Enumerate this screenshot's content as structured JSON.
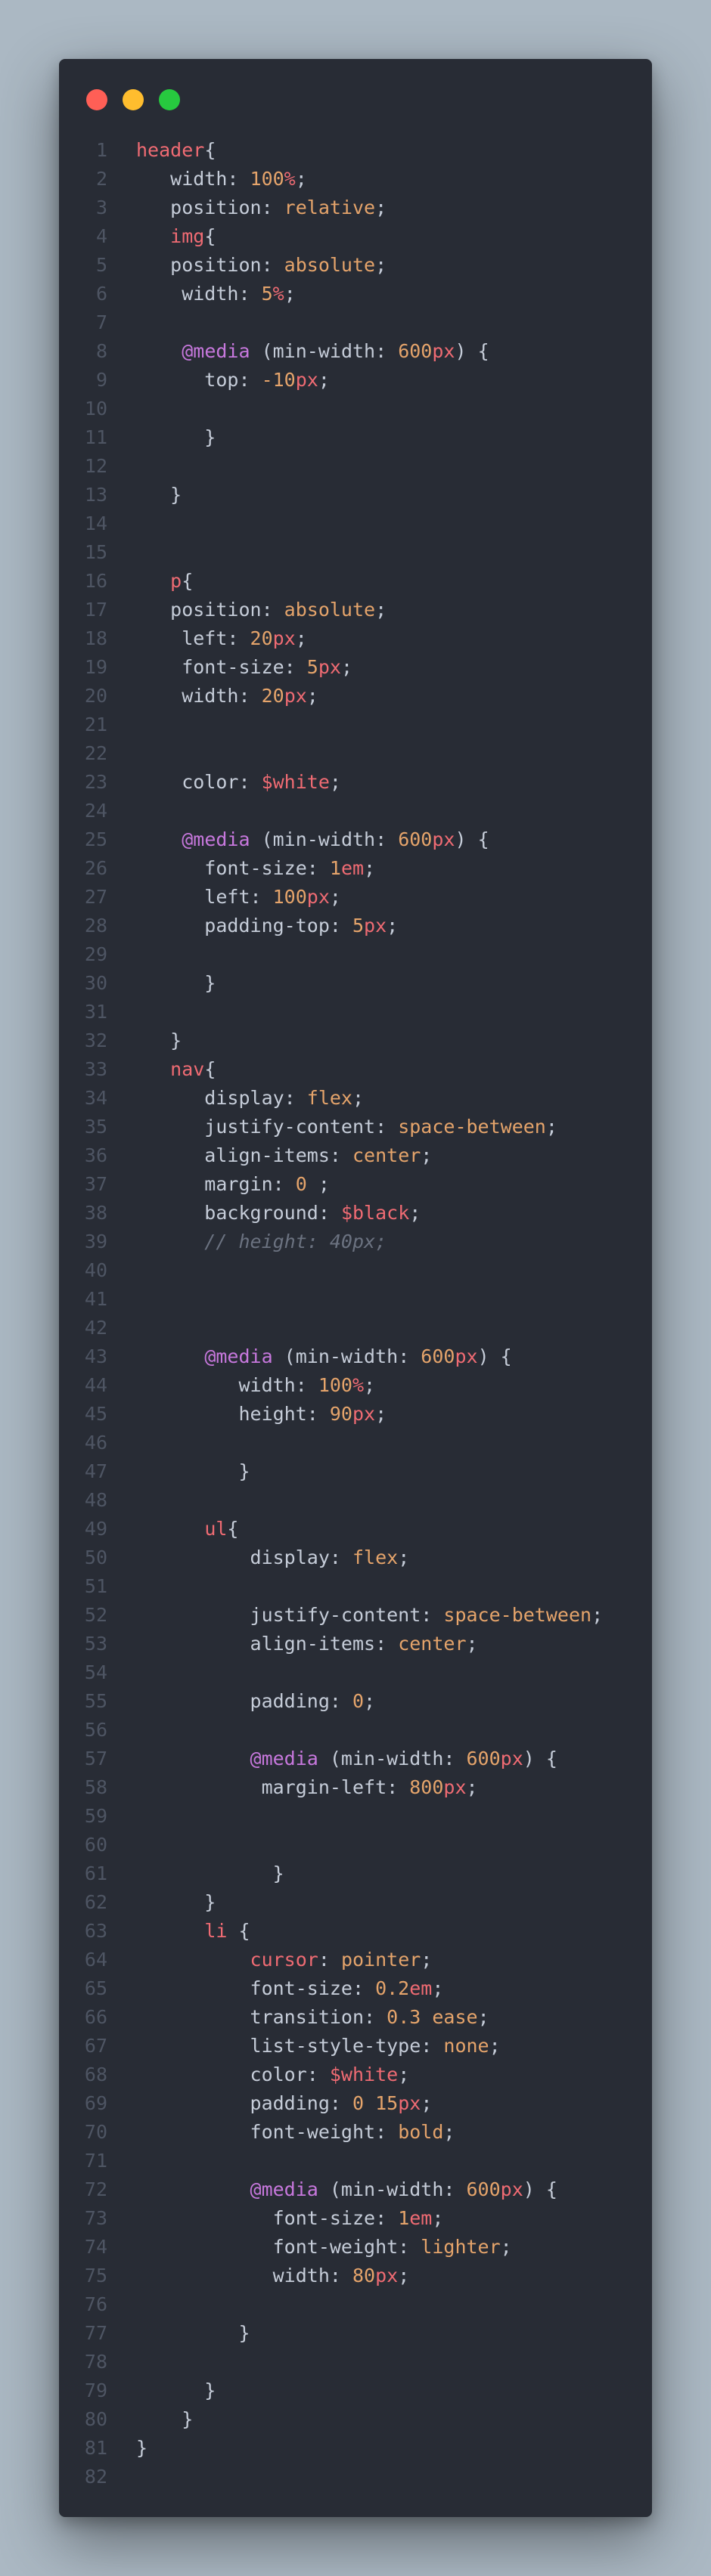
{
  "window": {
    "controls": [
      {
        "name": "close",
        "color": "#ff5f56"
      },
      {
        "name": "minimize",
        "color": "#ffbd2e"
      },
      {
        "name": "maximize",
        "color": "#27c93f"
      }
    ]
  },
  "code": {
    "lines": [
      [
        {
          "t": "header",
          "c": "sel"
        },
        {
          "t": "{",
          "c": "pun"
        }
      ],
      [
        {
          "t": "   width: ",
          "c": "prop"
        },
        {
          "t": "100",
          "c": "num"
        },
        {
          "t": "%",
          "c": "unit"
        },
        {
          "t": ";",
          "c": "pun"
        }
      ],
      [
        {
          "t": "   position: ",
          "c": "prop"
        },
        {
          "t": "relative",
          "c": "val"
        },
        {
          "t": ";",
          "c": "pun"
        }
      ],
      [
        {
          "t": "   ",
          "c": "pun"
        },
        {
          "t": "img",
          "c": "sel"
        },
        {
          "t": "{",
          "c": "pun"
        }
      ],
      [
        {
          "t": "   position: ",
          "c": "prop"
        },
        {
          "t": "absolute",
          "c": "val"
        },
        {
          "t": ";",
          "c": "pun"
        }
      ],
      [
        {
          "t": "    width: ",
          "c": "prop"
        },
        {
          "t": "5",
          "c": "num"
        },
        {
          "t": "%",
          "c": "unit"
        },
        {
          "t": ";",
          "c": "pun"
        }
      ],
      [],
      [
        {
          "t": "    ",
          "c": "pun"
        },
        {
          "t": "@media",
          "c": "at"
        },
        {
          "t": " (min-width: ",
          "c": "prop"
        },
        {
          "t": "600",
          "c": "num"
        },
        {
          "t": "px",
          "c": "unit"
        },
        {
          "t": ") {",
          "c": "pun"
        }
      ],
      [
        {
          "t": "      top: ",
          "c": "prop"
        },
        {
          "t": "-10",
          "c": "num"
        },
        {
          "t": "px",
          "c": "unit"
        },
        {
          "t": ";",
          "c": "pun"
        }
      ],
      [],
      [
        {
          "t": "      }",
          "c": "pun"
        }
      ],
      [],
      [
        {
          "t": "   }",
          "c": "pun"
        }
      ],
      [],
      [],
      [
        {
          "t": "   ",
          "c": "pun"
        },
        {
          "t": "p",
          "c": "sel"
        },
        {
          "t": "{",
          "c": "pun"
        }
      ],
      [
        {
          "t": "   position: ",
          "c": "prop"
        },
        {
          "t": "absolute",
          "c": "val"
        },
        {
          "t": ";",
          "c": "pun"
        }
      ],
      [
        {
          "t": "    left: ",
          "c": "prop"
        },
        {
          "t": "20",
          "c": "num"
        },
        {
          "t": "px",
          "c": "unit"
        },
        {
          "t": ";",
          "c": "pun"
        }
      ],
      [
        {
          "t": "    font-size: ",
          "c": "prop"
        },
        {
          "t": "5",
          "c": "num"
        },
        {
          "t": "px",
          "c": "unit"
        },
        {
          "t": ";",
          "c": "pun"
        }
      ],
      [
        {
          "t": "    width: ",
          "c": "prop"
        },
        {
          "t": "20",
          "c": "num"
        },
        {
          "t": "px",
          "c": "unit"
        },
        {
          "t": ";",
          "c": "pun"
        }
      ],
      [],
      [],
      [
        {
          "t": "    color: ",
          "c": "prop"
        },
        {
          "t": "$white",
          "c": "var"
        },
        {
          "t": ";",
          "c": "pun"
        }
      ],
      [],
      [
        {
          "t": "    ",
          "c": "pun"
        },
        {
          "t": "@media",
          "c": "at"
        },
        {
          "t": " (min-width: ",
          "c": "prop"
        },
        {
          "t": "600",
          "c": "num"
        },
        {
          "t": "px",
          "c": "unit"
        },
        {
          "t": ") {",
          "c": "pun"
        }
      ],
      [
        {
          "t": "      font-size: ",
          "c": "prop"
        },
        {
          "t": "1",
          "c": "num"
        },
        {
          "t": "em",
          "c": "unit"
        },
        {
          "t": ";",
          "c": "pun"
        }
      ],
      [
        {
          "t": "      left: ",
          "c": "prop"
        },
        {
          "t": "100",
          "c": "num"
        },
        {
          "t": "px",
          "c": "unit"
        },
        {
          "t": ";",
          "c": "pun"
        }
      ],
      [
        {
          "t": "      padding-top: ",
          "c": "prop"
        },
        {
          "t": "5",
          "c": "num"
        },
        {
          "t": "px",
          "c": "unit"
        },
        {
          "t": ";",
          "c": "pun"
        }
      ],
      [],
      [
        {
          "t": "      }",
          "c": "pun"
        }
      ],
      [],
      [
        {
          "t": "   }",
          "c": "pun"
        }
      ],
      [
        {
          "t": "   ",
          "c": "pun"
        },
        {
          "t": "nav",
          "c": "sel"
        },
        {
          "t": "{",
          "c": "pun"
        }
      ],
      [
        {
          "t": "      display: ",
          "c": "prop"
        },
        {
          "t": "flex",
          "c": "val"
        },
        {
          "t": ";",
          "c": "pun"
        }
      ],
      [
        {
          "t": "      justify-content: ",
          "c": "prop"
        },
        {
          "t": "space-between",
          "c": "val"
        },
        {
          "t": ";",
          "c": "pun"
        }
      ],
      [
        {
          "t": "      align-items: ",
          "c": "prop"
        },
        {
          "t": "center",
          "c": "val"
        },
        {
          "t": ";",
          "c": "pun"
        }
      ],
      [
        {
          "t": "      margin: ",
          "c": "prop"
        },
        {
          "t": "0",
          "c": "num"
        },
        {
          "t": " ;",
          "c": "pun"
        }
      ],
      [
        {
          "t": "      background: ",
          "c": "prop"
        },
        {
          "t": "$black",
          "c": "var"
        },
        {
          "t": ";",
          "c": "pun"
        }
      ],
      [
        {
          "t": "      // height: 40px;",
          "c": "cmt"
        }
      ],
      [],
      [],
      [],
      [
        {
          "t": "      ",
          "c": "pun"
        },
        {
          "t": "@media",
          "c": "at"
        },
        {
          "t": " (min-width: ",
          "c": "prop"
        },
        {
          "t": "600",
          "c": "num"
        },
        {
          "t": "px",
          "c": "unit"
        },
        {
          "t": ") {",
          "c": "pun"
        }
      ],
      [
        {
          "t": "         width: ",
          "c": "prop"
        },
        {
          "t": "100",
          "c": "num"
        },
        {
          "t": "%",
          "c": "unit"
        },
        {
          "t": ";",
          "c": "pun"
        }
      ],
      [
        {
          "t": "         height: ",
          "c": "prop"
        },
        {
          "t": "90",
          "c": "num"
        },
        {
          "t": "px",
          "c": "unit"
        },
        {
          "t": ";",
          "c": "pun"
        }
      ],
      [],
      [
        {
          "t": "         }",
          "c": "pun"
        }
      ],
      [],
      [
        {
          "t": "      ",
          "c": "pun"
        },
        {
          "t": "ul",
          "c": "sel"
        },
        {
          "t": "{",
          "c": "pun"
        }
      ],
      [
        {
          "t": "          display: ",
          "c": "prop"
        },
        {
          "t": "flex",
          "c": "val"
        },
        {
          "t": ";",
          "c": "pun"
        }
      ],
      [],
      [
        {
          "t": "          justify-content: ",
          "c": "prop"
        },
        {
          "t": "space-between",
          "c": "val"
        },
        {
          "t": ";",
          "c": "pun"
        }
      ],
      [
        {
          "t": "          align-items: ",
          "c": "prop"
        },
        {
          "t": "center",
          "c": "val"
        },
        {
          "t": ";",
          "c": "pun"
        }
      ],
      [],
      [
        {
          "t": "          padding: ",
          "c": "prop"
        },
        {
          "t": "0",
          "c": "num"
        },
        {
          "t": ";",
          "c": "pun"
        }
      ],
      [],
      [
        {
          "t": "          ",
          "c": "pun"
        },
        {
          "t": "@media",
          "c": "at"
        },
        {
          "t": " (min-width: ",
          "c": "prop"
        },
        {
          "t": "600",
          "c": "num"
        },
        {
          "t": "px",
          "c": "unit"
        },
        {
          "t": ") {",
          "c": "pun"
        }
      ],
      [
        {
          "t": "           margin-left: ",
          "c": "prop"
        },
        {
          "t": "800",
          "c": "num"
        },
        {
          "t": "px",
          "c": "unit"
        },
        {
          "t": ";",
          "c": "pun"
        }
      ],
      [],
      [],
      [
        {
          "t": "            }",
          "c": "pun"
        }
      ],
      [
        {
          "t": "      }",
          "c": "pun"
        }
      ],
      [
        {
          "t": "      ",
          "c": "pun"
        },
        {
          "t": "li",
          "c": "sel"
        },
        {
          "t": " {",
          "c": "pun"
        }
      ],
      [
        {
          "t": "          ",
          "c": "pun"
        },
        {
          "t": "cursor",
          "c": "prophl"
        },
        {
          "t": ": ",
          "c": "prop"
        },
        {
          "t": "pointer",
          "c": "val"
        },
        {
          "t": ";",
          "c": "pun"
        }
      ],
      [
        {
          "t": "          font-size: ",
          "c": "prop"
        },
        {
          "t": "0.2",
          "c": "num"
        },
        {
          "t": "em",
          "c": "unit"
        },
        {
          "t": ";",
          "c": "pun"
        }
      ],
      [
        {
          "t": "          transition: ",
          "c": "prop"
        },
        {
          "t": "0.3",
          "c": "num"
        },
        {
          "t": " ease",
          "c": "val"
        },
        {
          "t": ";",
          "c": "pun"
        }
      ],
      [
        {
          "t": "          list-style-type: ",
          "c": "prop"
        },
        {
          "t": "none",
          "c": "val"
        },
        {
          "t": ";",
          "c": "pun"
        }
      ],
      [
        {
          "t": "          color: ",
          "c": "prop"
        },
        {
          "t": "$white",
          "c": "var"
        },
        {
          "t": ";",
          "c": "pun"
        }
      ],
      [
        {
          "t": "          padding: ",
          "c": "prop"
        },
        {
          "t": "0 15",
          "c": "num"
        },
        {
          "t": "px",
          "c": "unit"
        },
        {
          "t": ";",
          "c": "pun"
        }
      ],
      [
        {
          "t": "          font-weight: ",
          "c": "prop"
        },
        {
          "t": "bold",
          "c": "val"
        },
        {
          "t": ";",
          "c": "pun"
        }
      ],
      [],
      [
        {
          "t": "          ",
          "c": "pun"
        },
        {
          "t": "@media",
          "c": "at"
        },
        {
          "t": " (min-width: ",
          "c": "prop"
        },
        {
          "t": "600",
          "c": "num"
        },
        {
          "t": "px",
          "c": "unit"
        },
        {
          "t": ") {",
          "c": "pun"
        }
      ],
      [
        {
          "t": "            font-size: ",
          "c": "prop"
        },
        {
          "t": "1",
          "c": "num"
        },
        {
          "t": "em",
          "c": "unit"
        },
        {
          "t": ";",
          "c": "pun"
        }
      ],
      [
        {
          "t": "            font-weight: ",
          "c": "prop"
        },
        {
          "t": "lighter",
          "c": "val"
        },
        {
          "t": ";",
          "c": "pun"
        }
      ],
      [
        {
          "t": "            width: ",
          "c": "prop"
        },
        {
          "t": "80",
          "c": "num"
        },
        {
          "t": "px",
          "c": "unit"
        },
        {
          "t": ";",
          "c": "pun"
        }
      ],
      [],
      [
        {
          "t": "         }",
          "c": "pun"
        }
      ],
      [],
      [
        {
          "t": "      }",
          "c": "pun"
        }
      ],
      [
        {
          "t": "    }",
          "c": "pun"
        }
      ],
      [
        {
          "t": "}",
          "c": "pun"
        }
      ],
      []
    ]
  }
}
